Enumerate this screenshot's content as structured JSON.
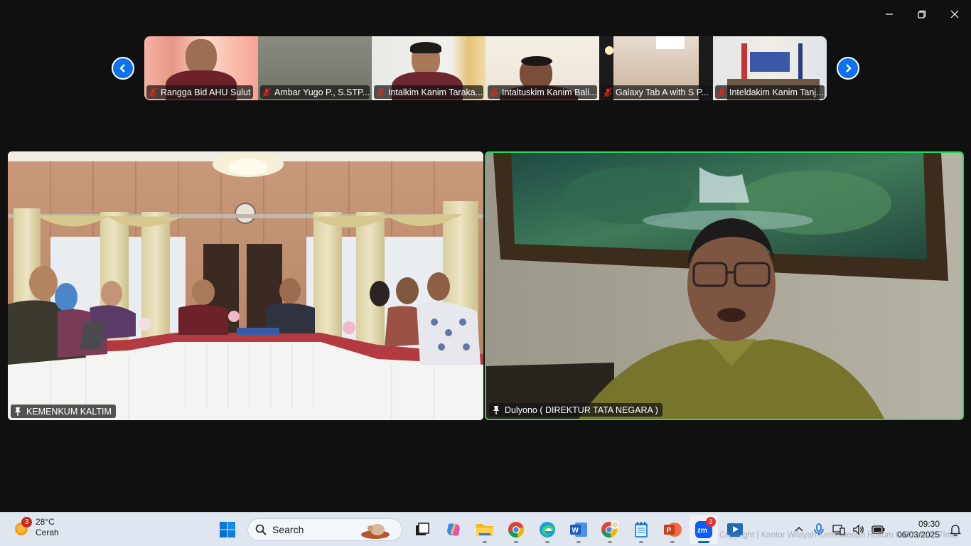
{
  "window": {
    "minimize_icon": "minimize-icon",
    "restore_icon": "restore-icon",
    "close_icon": "close-icon"
  },
  "gallery": {
    "prev_icon": "chevron-left-icon",
    "next_icon": "chevron-right-icon",
    "participants": [
      {
        "name": "Rangga Bid AHU Sulut",
        "muted": true
      },
      {
        "name": "Ambar Yugo P., S.STP...",
        "muted": true
      },
      {
        "name": "Intalkim Kanim Taraka...",
        "muted": true
      },
      {
        "name": "Intaltuskim Kanim Bali...",
        "muted": true
      },
      {
        "name": "Galaxy Tab A with S P...",
        "muted": true
      },
      {
        "name": "Inteldakim Kanim Tanj...",
        "muted": true
      }
    ]
  },
  "main": {
    "left": {
      "name": "KEMENKUM KALTIM",
      "pinned": true
    },
    "right": {
      "name": "Dulyono ( DIREKTUR TATA NEGARA  )",
      "pinned": true,
      "active_speaker": true
    }
  },
  "taskbar": {
    "weather": {
      "badge": "3",
      "temp": "28°C",
      "condition": "Cerah"
    },
    "search_placeholder": "Search",
    "zoom_badge": "2",
    "clock": {
      "time": "09:30",
      "date": "06/03/2025"
    },
    "watermark": "Copyright | Kantor Wilayah Kementerian Hukum Kalimantan Timur"
  },
  "colors": {
    "accent": "#0e72ed",
    "active_speaker_border": "#23d959",
    "mute_red": "#e0251b"
  }
}
